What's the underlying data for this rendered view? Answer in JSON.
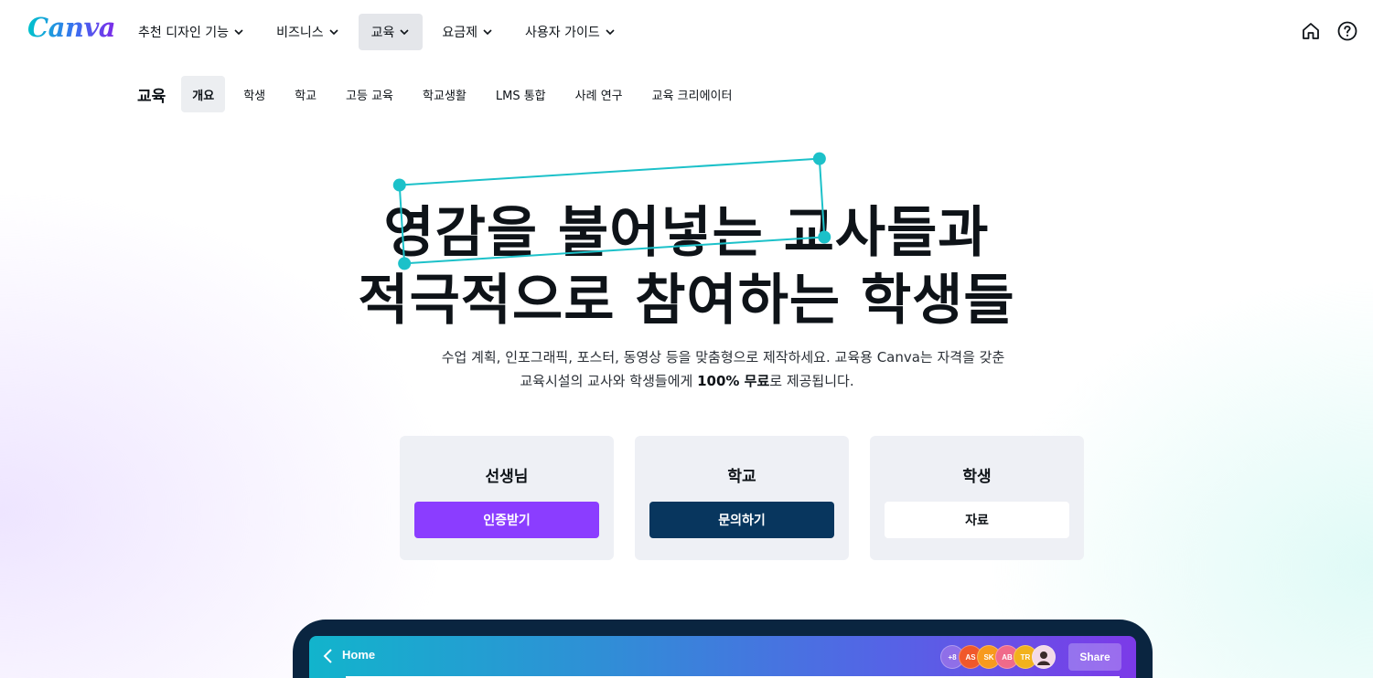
{
  "brand": {
    "logo_text": "Canva",
    "colors": {
      "teal": "#00c4cc",
      "purple": "#8b3dff",
      "navy": "#08365e",
      "frame": "#1cc1c9"
    }
  },
  "main_nav": {
    "items": [
      {
        "label": "추천 디자인 기능",
        "active": false
      },
      {
        "label": "비즈니스",
        "active": false
      },
      {
        "label": "교육",
        "active": true
      },
      {
        "label": "요금제",
        "active": false
      },
      {
        "label": "사용자 가이드",
        "active": false
      }
    ],
    "icons": [
      "home-icon",
      "help-icon"
    ]
  },
  "sub_nav": {
    "title": "교육",
    "items": [
      {
        "label": "개요",
        "active": true
      },
      {
        "label": "학생",
        "active": false
      },
      {
        "label": "학교",
        "active": false
      },
      {
        "label": "고등 교육",
        "active": false
      },
      {
        "label": "학교생활",
        "active": false
      },
      {
        "label": "LMS 통합",
        "active": false
      },
      {
        "label": "사례 연구",
        "active": false
      },
      {
        "label": "교육 크리에이터",
        "active": false
      }
    ]
  },
  "hero": {
    "line1_highlight": "영감을 불어넣는",
    "line1_rest": "교사들과",
    "line2": "적극적으로 참여하는 학생들",
    "desc_line1": "수업 계획, 인포그래픽, 포스터, 동영상 등을 맞춤형으로 제작하세요. 교육용 Canva는 자격을 갖춘",
    "desc_line2_pre": "교육시설의 교사와 학생들에게 ",
    "desc_line2_bold": "100% 무료",
    "desc_line2_post": "로 제공됩니다."
  },
  "cards": [
    {
      "title": "선생님",
      "button": "인증받기",
      "style": "purple"
    },
    {
      "title": "학교",
      "button": "문의하기",
      "style": "navy"
    },
    {
      "title": "학생",
      "button": "자료",
      "style": "white"
    }
  ],
  "preview": {
    "back_icon": "chevron-left-icon",
    "home_label": "Home",
    "avatars": [
      {
        "text": "+8",
        "color": "#8f6fe8"
      },
      {
        "text": "AS",
        "color": "#f0582a"
      },
      {
        "text": "SK",
        "color": "#f79a1e"
      },
      {
        "text": "AB",
        "color": "#f06a8a"
      },
      {
        "text": "TR",
        "color": "#f2b21c"
      },
      {
        "text": "",
        "color": "#f3d9e6"
      }
    ],
    "share_label": "Share"
  }
}
